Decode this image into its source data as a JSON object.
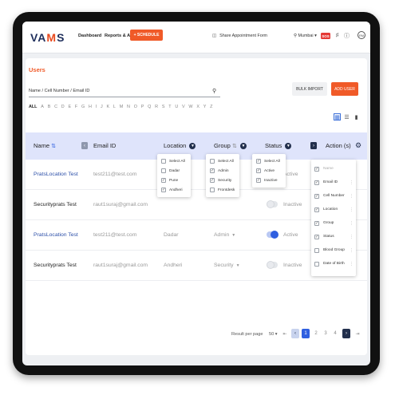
{
  "header": {
    "logo": "VAMS",
    "nav": [
      "Dashboard",
      "Reports & Analytics"
    ],
    "schedule_button": "+ SCHEDULE",
    "share_label": "Share Appointment Form",
    "location": "Mumbai",
    "sos": "SOS",
    "avatar": "RM"
  },
  "page": {
    "title": "Users",
    "search_placeholder": "Name / Cell Number / Email ID",
    "bulk_import": "BULK IMPORT",
    "add_user": "ADD USER",
    "alphabet": [
      "ALL",
      "A",
      "B",
      "C",
      "D",
      "E",
      "F",
      "G",
      "H",
      "I",
      "J",
      "K",
      "L",
      "M",
      "N",
      "O",
      "P",
      "Q",
      "R",
      "S",
      "T",
      "U",
      "V",
      "W",
      "X",
      "Y",
      "Z"
    ]
  },
  "table": {
    "columns": {
      "name": "Name",
      "email": "Email ID",
      "location": "Location",
      "group": "Group",
      "status": "Status",
      "action": "Action (s)"
    },
    "rows": [
      {
        "name": "PratsLocation Test",
        "email": "test211@test.com",
        "location": "",
        "group": "",
        "status": "Active",
        "link": true
      },
      {
        "name": "Securityprats Test",
        "email": "raut1suraj@gmail.com",
        "location": "",
        "group": "",
        "status": "Inactive",
        "link": false
      },
      {
        "name": "PratsLocation Test",
        "email": "test211@test.com",
        "location": "Dadar",
        "group": "Admin",
        "status": "Active",
        "link": true
      },
      {
        "name": "Securityprats Test",
        "email": "raut1suraj@gmail.com",
        "location": "Andheri",
        "group": "Security",
        "status": "Inactive",
        "link": false
      }
    ]
  },
  "location_filter": {
    "options": [
      "Select All",
      "Dadar",
      "Pune",
      "Andheri"
    ],
    "checked": [
      false,
      false,
      true,
      true
    ]
  },
  "group_filter": {
    "options": [
      "Select All",
      "Admin",
      "Security",
      "Frontdesk"
    ],
    "checked": [
      false,
      true,
      true,
      false
    ]
  },
  "status_filter": {
    "options": [
      "Select All",
      "Active",
      "Inactive"
    ],
    "checked": [
      true,
      true,
      true
    ]
  },
  "column_picker": {
    "options": [
      "Name",
      "Email ID",
      "Cell Number",
      "Location",
      "Group",
      "Status",
      "Blood Group",
      "Date of Birth"
    ],
    "checked": [
      true,
      true,
      true,
      true,
      true,
      true,
      false,
      false
    ]
  },
  "pagination": {
    "label": "Result per page",
    "page_size": "50",
    "pages": [
      "1",
      "2",
      "3",
      "4"
    ],
    "current": "1"
  },
  "colors": {
    "accent": "#f05a28",
    "primary": "#2f5fe0",
    "header_bg": "#dfe4fb",
    "navy": "#23304d"
  }
}
